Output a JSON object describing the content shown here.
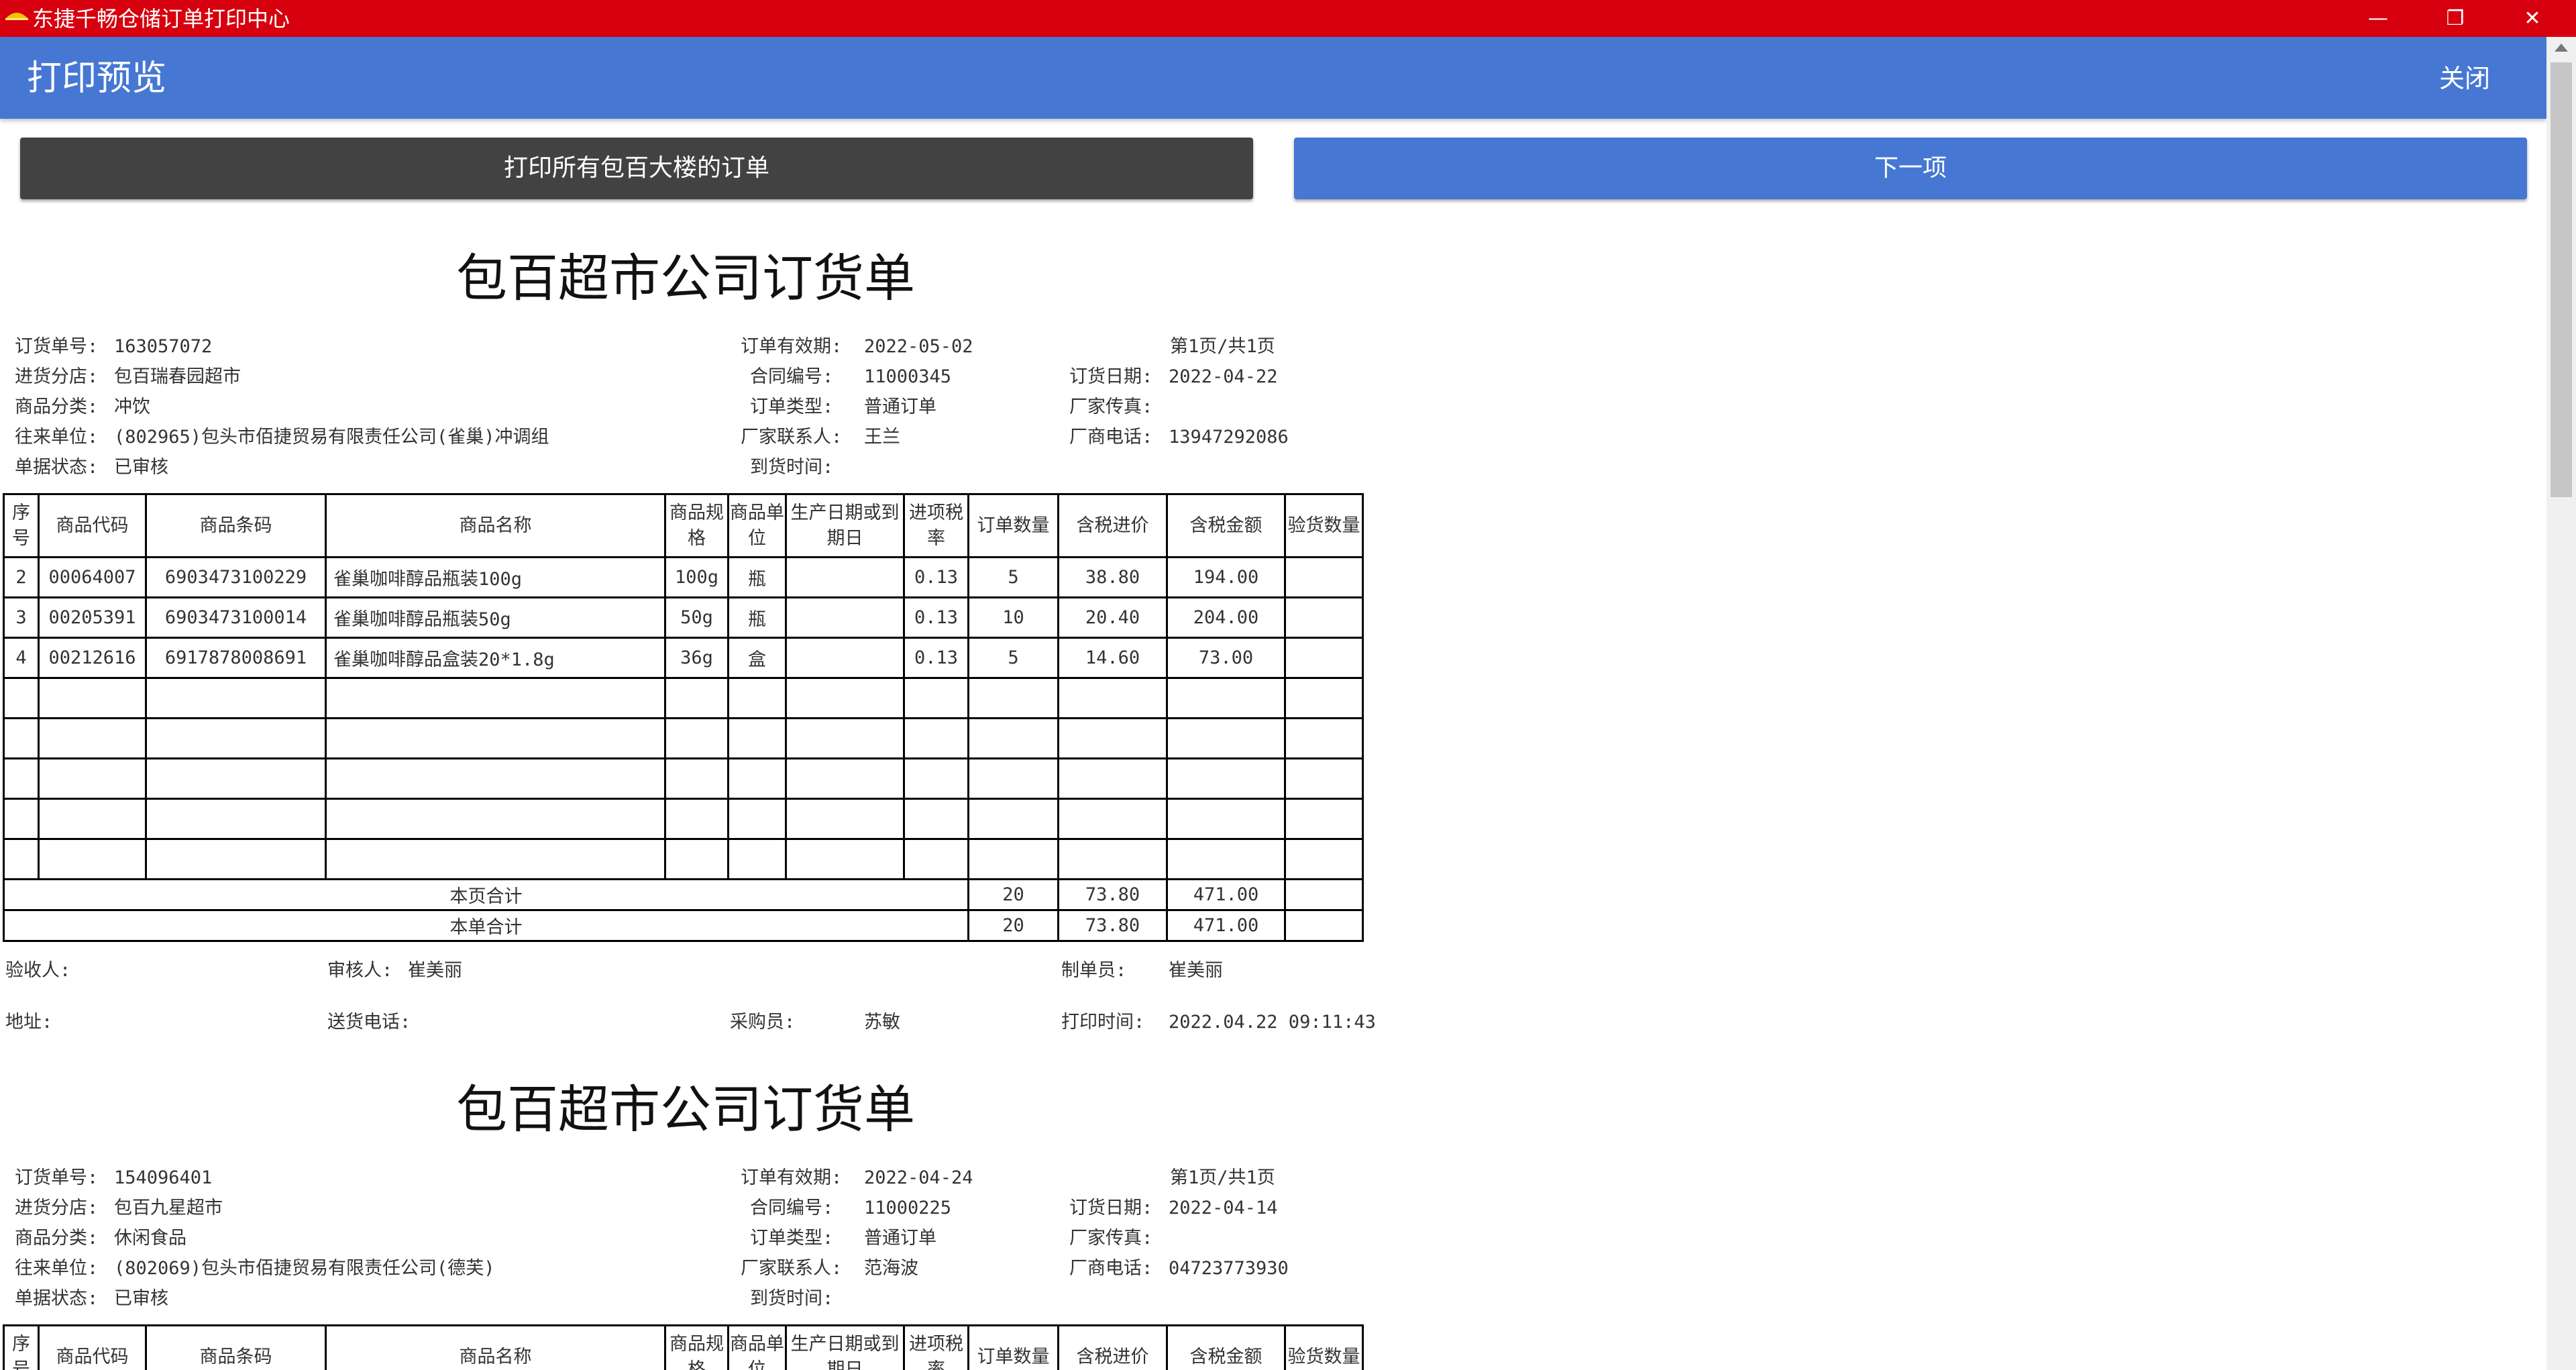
{
  "window": {
    "title": "东捷千畅仓储订单打印中心",
    "minimize": "—",
    "restore": "❐",
    "close": "✕"
  },
  "header": {
    "title": "打印预览",
    "close_label": "关闭"
  },
  "buttons": {
    "print_all": "打印所有包百大楼的订单",
    "next": "下一项"
  },
  "colors": {
    "titlebar": "#d6000f",
    "header": "#4677d3",
    "print_button": "#424242",
    "next_button": "#4677d3"
  },
  "columns": [
    "序号",
    "商品代码",
    "商品条码",
    "商品名称",
    "商品规格",
    "商品单位",
    "生产日期或到期日",
    "进项税率",
    "订单数量",
    "含税进价",
    "含税金额",
    "验货数量"
  ],
  "orders": [
    {
      "title": "包百超市公司订货单",
      "info": {
        "order_no_label": "订货单号:",
        "order_no": "163057072",
        "valid_label": "订单有效期:",
        "valid": "2022-05-02",
        "page": "第1页/共1页",
        "branch_label": "进货分店:",
        "branch": "包百瑞春园超市",
        "contract_label": "合同编号:",
        "contract": "11000345",
        "order_date_label": "订货日期:",
        "order_date": "2022-04-22",
        "category_label": "商品分类:",
        "category": "冲饮",
        "type_label": "订单类型:",
        "type": "普通订单",
        "fax_label": "厂家传真:",
        "fax": "",
        "partner_label": "往来单位:",
        "partner": "(802965)包头市佰捷贸易有限责任公司(雀巢)冲调组",
        "contact_label": "厂家联系人:",
        "contact": "王兰",
        "phone_label": "厂商电话:",
        "phone": "13947292086",
        "status_label": "单据状态:",
        "status": "已审核",
        "arrival_label": "到货时间:",
        "arrival": ""
      },
      "rows": [
        [
          "2",
          "00064007",
          "6903473100229",
          "雀巢咖啡醇品瓶装100g",
          "100g",
          "瓶",
          "",
          "0.13",
          "5",
          "38.80",
          "194.00",
          ""
        ],
        [
          "3",
          "00205391",
          "6903473100014",
          "雀巢咖啡醇品瓶装50g",
          "50g",
          "瓶",
          "",
          "0.13",
          "10",
          "20.40",
          "204.00",
          ""
        ],
        [
          "4",
          "00212616",
          "6917878008691",
          "雀巢咖啡醇品盒装20*1.8g",
          "36g",
          "盒",
          "",
          "0.13",
          "5",
          "14.60",
          "73.00",
          ""
        ],
        [
          "",
          "",
          "",
          "",
          "",
          "",
          "",
          "",
          "",
          "",
          "",
          ""
        ],
        [
          "",
          "",
          "",
          "",
          "",
          "",
          "",
          "",
          "",
          "",
          "",
          ""
        ],
        [
          "",
          "",
          "",
          "",
          "",
          "",
          "",
          "",
          "",
          "",
          "",
          ""
        ],
        [
          "",
          "",
          "",
          "",
          "",
          "",
          "",
          "",
          "",
          "",
          "",
          ""
        ],
        [
          "",
          "",
          "",
          "",
          "",
          "",
          "",
          "",
          "",
          "",
          "",
          ""
        ]
      ],
      "page_total": {
        "label": "本页合计",
        "qty": "20",
        "price": "73.80",
        "amount": "471.00"
      },
      "order_total": {
        "label": "本单合计",
        "qty": "20",
        "price": "73.80",
        "amount": "471.00"
      },
      "footer": {
        "receiver_label": "验收人:",
        "receiver": "",
        "reviewer_label": "审核人:",
        "reviewer": "崔美丽",
        "maker_label": "制单员:",
        "maker": "崔美丽",
        "address_label": "地址:",
        "address": "",
        "delivery_phone_label": "送货电话:",
        "delivery_phone": "",
        "buyer_label": "采购员:",
        "buyer": "苏敏",
        "print_time_label": "打印时间:",
        "print_time": "2022.04.22 09:11:43"
      }
    },
    {
      "title": "包百超市公司订货单",
      "info": {
        "order_no_label": "订货单号:",
        "order_no": "154096401",
        "valid_label": "订单有效期:",
        "valid": "2022-04-24",
        "page": "第1页/共1页",
        "branch_label": "进货分店:",
        "branch": "包百九星超市",
        "contract_label": "合同编号:",
        "contract": "11000225",
        "order_date_label": "订货日期:",
        "order_date": "2022-04-14",
        "category_label": "商品分类:",
        "category": "休闲食品",
        "type_label": "订单类型:",
        "type": "普通订单",
        "fax_label": "厂家传真:",
        "fax": "",
        "partner_label": "往来单位:",
        "partner": "(802069)包头市佰捷贸易有限责任公司(德芙)",
        "contact_label": "厂家联系人:",
        "contact": "范海波",
        "phone_label": "厂商电话:",
        "phone": "04723773930",
        "status_label": "单据状态:",
        "status": "已审核",
        "arrival_label": "到货时间:",
        "arrival": ""
      }
    }
  ]
}
